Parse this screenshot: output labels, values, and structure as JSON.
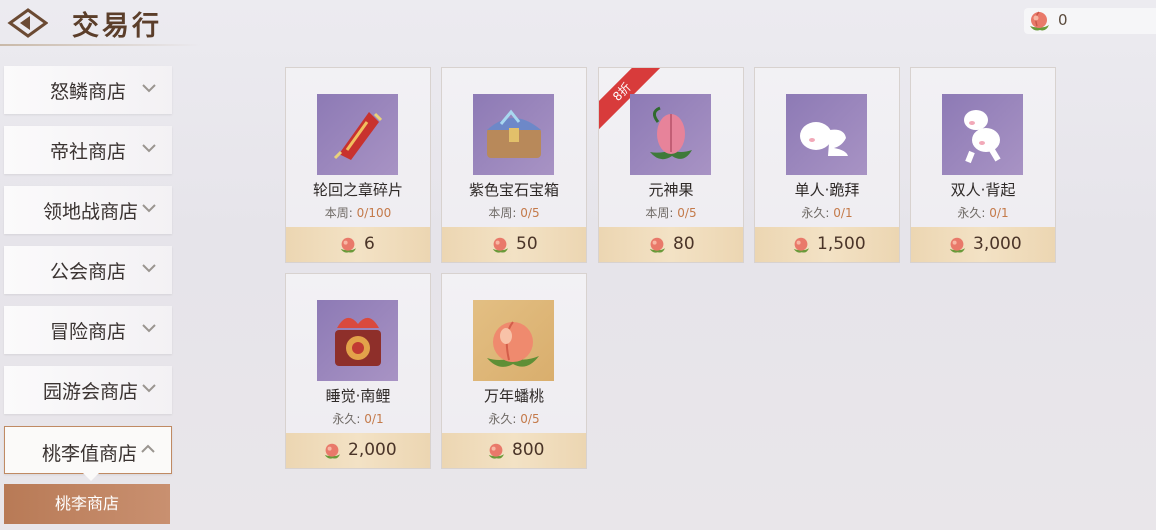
{
  "header": {
    "title": "交易行",
    "currency_amount": "0"
  },
  "sidebar": {
    "items": [
      {
        "label": "怒鳞商店"
      },
      {
        "label": "帝社商店"
      },
      {
        "label": "领地战商店"
      },
      {
        "label": "公会商店"
      },
      {
        "label": "冒险商店"
      },
      {
        "label": "园游会商店"
      },
      {
        "label": "桃李值商店",
        "active": true
      }
    ],
    "sub_items": [
      {
        "label": "桃李商店",
        "selected": true
      }
    ]
  },
  "items": [
    {
      "name": "轮回之章碎片",
      "limit_label": "本周:",
      "limit_value": "0/100",
      "price": "6",
      "icon": "scroll-fragment-icon"
    },
    {
      "name": "紫色宝石宝箱",
      "limit_label": "本周:",
      "limit_value": "0/5",
      "price": "50",
      "icon": "treasure-chest-icon"
    },
    {
      "name": "元神果",
      "limit_label": "本周:",
      "limit_value": "0/5",
      "price": "80",
      "icon": "spirit-fruit-icon",
      "badge": "8折"
    },
    {
      "name": "单人·跪拜",
      "limit_label": "永久:",
      "limit_value": "0/1",
      "price": "1,500",
      "icon": "kneel-emote-icon"
    },
    {
      "name": "双人·背起",
      "limit_label": "永久:",
      "limit_value": "0/1",
      "price": "3,000",
      "icon": "piggyback-emote-icon"
    },
    {
      "name": "睡觉·南鲤",
      "limit_label": "永久:",
      "limit_value": "0/1",
      "price": "2,000",
      "icon": "sleep-koi-icon"
    },
    {
      "name": "万年蟠桃",
      "limit_label": "永久:",
      "limit_value": "0/5",
      "price": "800",
      "icon": "peach-icon"
    }
  ],
  "currency_icon": "peach-currency-icon",
  "colors": {
    "accent": "#c08a63",
    "price_bar": "#f0dcbb",
    "limit_value": "#c47a4a",
    "discount_badge": "#d83b3b"
  }
}
